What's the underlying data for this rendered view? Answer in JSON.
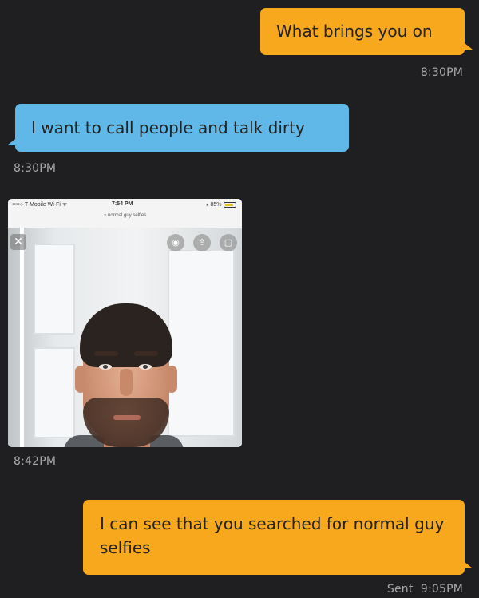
{
  "messages": [
    {
      "type": "text",
      "direction": "outgoing",
      "text": "What brings you on",
      "time": "8:30PM"
    },
    {
      "type": "text",
      "direction": "incoming",
      "text": "I want to call people and talk dirty",
      "time": "8:30PM"
    },
    {
      "type": "image",
      "direction": "incoming",
      "time": "8:42PM",
      "screenshot": {
        "carrier": "••••○ T-Mobile Wi-Fi ᯤ",
        "clock": "7:54 PM",
        "battery": "⁎ 85%",
        "battery_level": 0.85,
        "search_query": "⌕ normal guy selfies",
        "close_icon": "✕",
        "lens_icon": "◉",
        "share_icon": "⇪",
        "bookmark_icon": "▢"
      }
    },
    {
      "type": "text",
      "direction": "outgoing",
      "text": "I can see that you searched for normal guy selfies",
      "time": "Sent  9:05PM"
    }
  ],
  "colors": {
    "background": "#1f1f21",
    "outgoing_bubble": "#f7a81c",
    "incoming_bubble": "#5fb8e8",
    "timestamp": "#a9a9a9"
  }
}
